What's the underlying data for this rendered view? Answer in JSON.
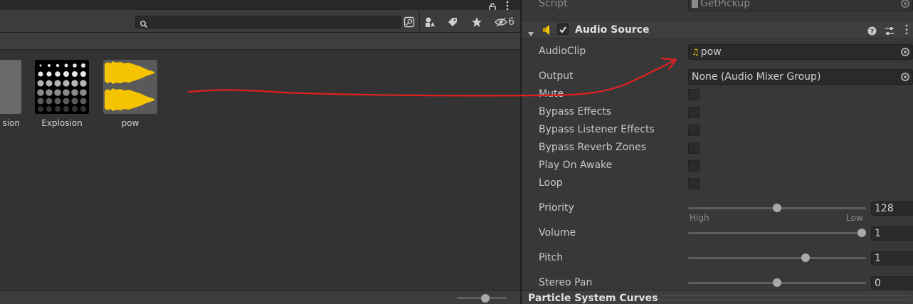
{
  "project": {
    "search": {
      "value": "",
      "placeholder": ""
    },
    "hidden_count": "6",
    "assets": [
      {
        "label": "sion"
      },
      {
        "label": "Explosion"
      },
      {
        "label": "pow"
      }
    ]
  },
  "inspector": {
    "script": {
      "label": "Script",
      "value": "GetPickup"
    },
    "component": {
      "title": "Audio Source",
      "enabled": true
    },
    "fields": {
      "audioclip": {
        "label": "AudioClip",
        "value": "pow"
      },
      "output": {
        "label": "Output",
        "value": "None (Audio Mixer Group)"
      },
      "mute": {
        "label": "Mute"
      },
      "bypass_effects": {
        "label": "Bypass Effects"
      },
      "bypass_listener": {
        "label": "Bypass Listener Effects"
      },
      "bypass_reverb": {
        "label": "Bypass Reverb Zones"
      },
      "play_on_awake": {
        "label": "Play On Awake"
      },
      "loop": {
        "label": "Loop"
      },
      "priority": {
        "label": "Priority",
        "value": "128",
        "fraction": 0.5,
        "min_label": "High",
        "max_label": "Low"
      },
      "volume": {
        "label": "Volume",
        "value": "1",
        "fraction": 1.0
      },
      "pitch": {
        "label": "Pitch",
        "value": "1",
        "fraction": 0.667
      },
      "stereo_pan": {
        "label": "Stereo Pan",
        "value": "0",
        "fraction": 0.5
      }
    },
    "next_component": {
      "title": "Particle System Curves"
    }
  },
  "colors": {
    "annotation_arrow": "#e02020",
    "audio_yellow": "#f5c400"
  }
}
